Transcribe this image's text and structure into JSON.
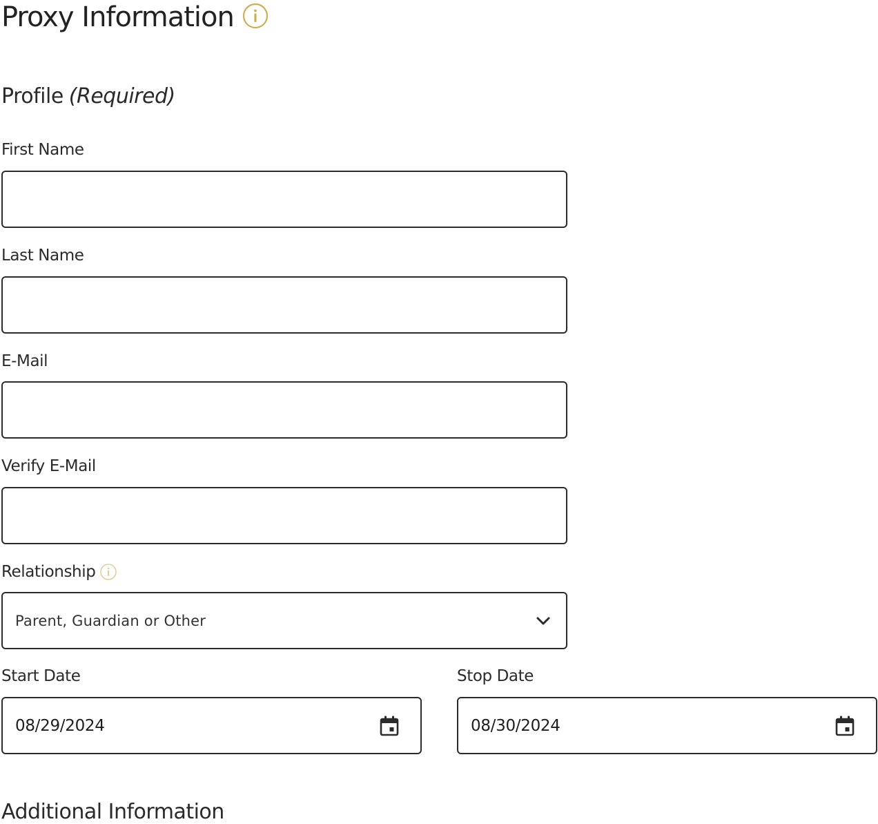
{
  "header": {
    "title": "Proxy Information"
  },
  "profile": {
    "heading": "Profile",
    "required": "(Required)"
  },
  "fields": {
    "first_name_label": "First Name",
    "first_name_value": "",
    "last_name_label": "Last Name",
    "last_name_value": "",
    "email_label": "E-Mail",
    "email_value": "",
    "verify_email_label": "Verify E-Mail",
    "verify_email_value": "",
    "relationship_label": "Relationship",
    "relationship_value": "Parent, Guardian or Other",
    "start_date_label": "Start Date",
    "start_date_value": "08/29/2024",
    "stop_date_label": "Stop Date",
    "stop_date_value": "08/30/2024"
  },
  "additional": {
    "heading": "Additional Information"
  },
  "icons": {
    "info": "info-icon",
    "chevron": "chevron-down-icon",
    "calendar": "calendar-icon"
  },
  "colors": {
    "info_accent": "#cfae52",
    "border": "#2b2b2b",
    "text": "#222222"
  }
}
